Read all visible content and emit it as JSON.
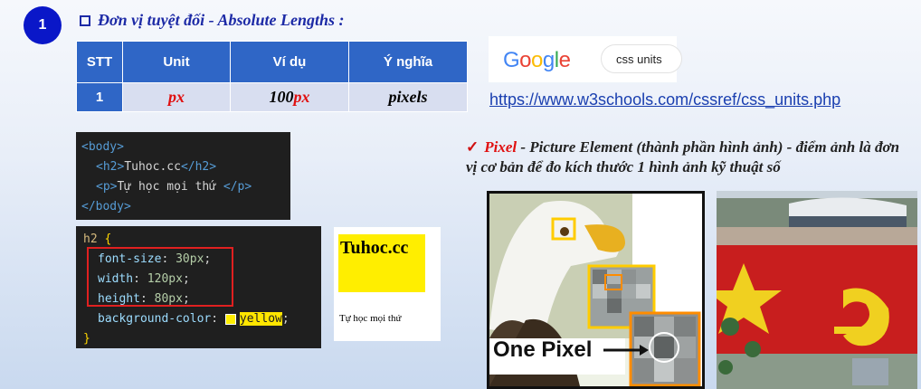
{
  "section": {
    "number": "1",
    "title": "Đơn vị tuyệt đối - Absolute Lengths :"
  },
  "table": {
    "headers": [
      "STT",
      "Unit",
      "Ví dụ",
      "Ý nghĩa"
    ],
    "row": {
      "stt": "1",
      "unit": "px",
      "example_num": "100",
      "example_unit": "px",
      "meaning": "pixels"
    }
  },
  "google": {
    "logo": "Google",
    "query": "css units"
  },
  "link": "https://www.w3schools.com/cssref/css_units.php",
  "html_code": {
    "line1": "<body>",
    "line2_open": "<h2>",
    "line2_text": "Tuhoc.cc",
    "line2_close": "</h2>",
    "line3_open": "<p>",
    "line3_text": "Tự học mọi thứ ",
    "line3_close": "</p>",
    "line4": "</body>"
  },
  "css_code": {
    "selector": "h2",
    "open": "{",
    "font_size_prop": "font-size",
    "font_size_val": "30px",
    "width_prop": "width",
    "width_val": "120px",
    "height_prop": "height",
    "height_val": "80px",
    "bg_prop": "background-color",
    "bg_val": "yellow",
    "close": "}"
  },
  "preview": {
    "h2": "Tuhoc.cc",
    "p": "Tự học mọi thứ"
  },
  "statement": {
    "check": "✓",
    "term": "Pixel",
    "text": " - Picture Element (thành phần hình ảnh) - điểm ảnh là đơn vị cơ bản để đo kích thước 1 hình ảnh kỹ thuật số"
  },
  "eagle_caption": "One Pixel",
  "colors": {
    "badge": "#0a17c8",
    "table_header": "#2f66c6",
    "accent_red": "#e01010",
    "highlight_yellow": "#ffee00"
  }
}
